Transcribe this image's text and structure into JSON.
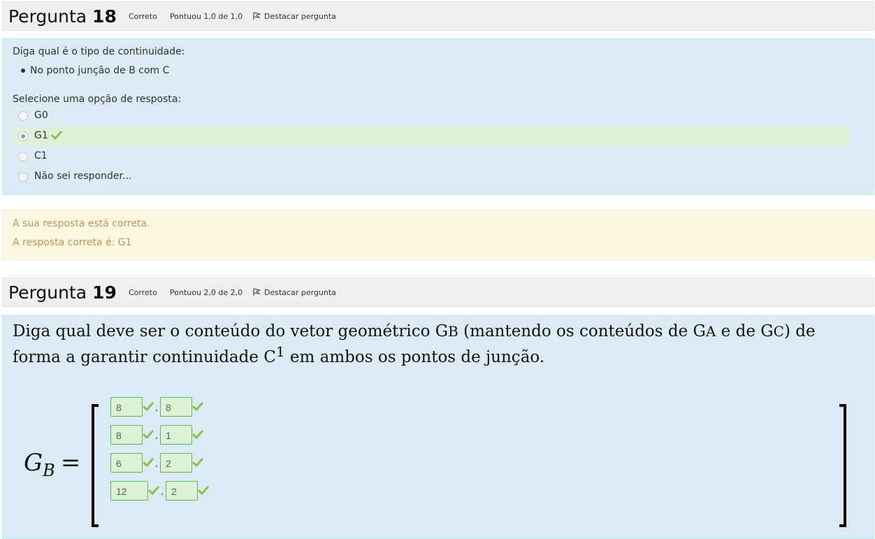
{
  "q18": {
    "label": "Pergunta",
    "number": "18",
    "status": "Correto",
    "score": "Pontuou 1,0 de 1,0",
    "flag": "Destacar pergunta",
    "question": "Diga qual é o tipo de continuidade:",
    "bullet": "No ponto junção de B com C",
    "prompt": "Selecione uma opção de resposta:",
    "options": [
      {
        "label": "G0",
        "selected": false
      },
      {
        "label": "G1",
        "selected": true,
        "correct": true
      },
      {
        "label": "C1",
        "selected": false
      },
      {
        "label": "Não sei responder...",
        "selected": false
      }
    ],
    "feedback": {
      "result": "A sua resposta está correta.",
      "answer": "A resposta correta é: G1"
    }
  },
  "q19": {
    "label": "Pergunta",
    "number": "19",
    "status": "Correto",
    "score": "Pontuou 2,0 de 2,0",
    "flag": "Destacar pergunta",
    "text_parts": {
      "p1": "Diga qual deve ser o conteúdo do vetor geométrico G",
      "s1": "B",
      "p2": " (mantendo os conteúdos de G",
      "s2": "A",
      "p3": " e de G",
      "s3": "C",
      "p4": ") de forma a garantir continuidade C",
      "sup": "1",
      "p5": " em ambos os pontos de junção."
    },
    "matrix_label": "G",
    "matrix_sub": "B",
    "matrix_eq": "=",
    "comma": ",",
    "rows": [
      [
        "8",
        "8"
      ],
      [
        "8",
        "1"
      ],
      [
        "6",
        "2"
      ],
      [
        "12",
        "2"
      ]
    ]
  },
  "colors": {
    "formulation_bg": "#dcebf3",
    "correct_bg": "#dff0d8",
    "feedback_bg": "#fcf8e3",
    "feedback_text": "#c09853",
    "check": "#8bc34a"
  }
}
